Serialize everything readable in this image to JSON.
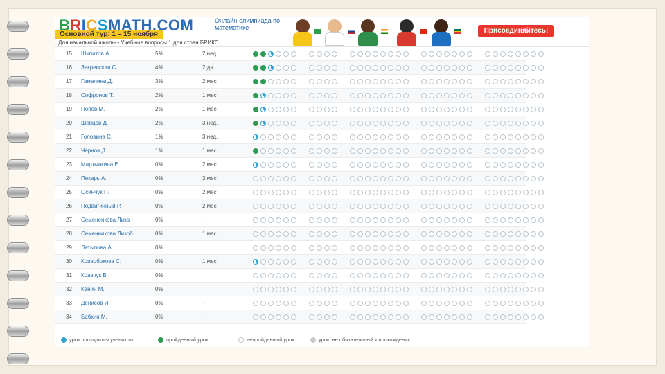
{
  "banner": {
    "logo": {
      "b": "B",
      "r": "R",
      "i": "I",
      "c": "C",
      "s": "S",
      "rest": "MATH.COM"
    },
    "tagline": "Онлайн-олимпиада по математике",
    "round_badge": "Основной тур: 1 – 15 ноября",
    "subtitle": "Для начальной школы • Учебные вопросы 1 для стран БРИКС",
    "join_button": "Присоединяйтесь!"
  },
  "colors": {
    "done": "#2e9b53",
    "in_progress": "#35a3d0",
    "not_done": "#ffffff",
    "optional": "#c8c8c8",
    "join_button": "#e8362d",
    "round_badge": "#f7c51f"
  },
  "students": [
    {
      "num": "15",
      "name": "Шипитов А.",
      "pct": "5%",
      "time": "2 нед.",
      "done": 2,
      "progress": 1
    },
    {
      "num": "16",
      "name": "Закревская С.",
      "pct": "4%",
      "time": "2 дн.",
      "done": 2,
      "progress": 1
    },
    {
      "num": "17",
      "name": "Гамалина Д.",
      "pct": "3%",
      "time": "2 мес",
      "done": 2,
      "progress": 0
    },
    {
      "num": "18",
      "name": "Софронов Т.",
      "pct": "2%",
      "time": "1 мес",
      "done": 1,
      "progress": 1
    },
    {
      "num": "19",
      "name": "Попов М.",
      "pct": "2%",
      "time": "1 мес",
      "done": 1,
      "progress": 1
    },
    {
      "num": "20",
      "name": "Шевцов Д.",
      "pct": "2%",
      "time": "3 нед.",
      "done": 1,
      "progress": 1
    },
    {
      "num": "21",
      "name": "Головина С.",
      "pct": "1%",
      "time": "3 нед.",
      "done": 0,
      "progress": 1
    },
    {
      "num": "22",
      "name": "Чернов Д.",
      "pct": "1%",
      "time": "1 мес",
      "done": 1,
      "progress": 0
    },
    {
      "num": "23",
      "name": "Мартынкина Е.",
      "pct": "0%",
      "time": "2 мес",
      "done": 0,
      "progress": 1
    },
    {
      "num": "24",
      "name": "Пекарь А.",
      "pct": "0%",
      "time": "3 мес",
      "done": 0,
      "progress": 0
    },
    {
      "num": "25",
      "name": "Осинчук П.",
      "pct": "0%",
      "time": "2 мес",
      "done": 0,
      "progress": 0
    },
    {
      "num": "26",
      "name": "Подвигичный Р.",
      "pct": "0%",
      "time": "2 мес",
      "done": 0,
      "progress": 0
    },
    {
      "num": "27",
      "name": "Семененкова Лиза",
      "pct": "0%",
      "time": "-",
      "done": 0,
      "progress": 0
    },
    {
      "num": "28",
      "name": "Семенникова Лизоб.",
      "pct": "0%",
      "time": "1 мес",
      "done": 0,
      "progress": 0
    },
    {
      "num": "29",
      "name": "Летыпова А.",
      "pct": "0%",
      "time": "",
      "done": 0,
      "progress": 0
    },
    {
      "num": "30",
      "name": "Кривобокова С.",
      "pct": "0%",
      "time": "1 мес",
      "done": 0,
      "progress": 1
    },
    {
      "num": "31",
      "name": "Кравчук В.",
      "pct": "0%",
      "time": "",
      "done": 0,
      "progress": 0
    },
    {
      "num": "32",
      "name": "Канин М.",
      "pct": "0%",
      "time": "",
      "done": 0,
      "progress": 0
    },
    {
      "num": "33",
      "name": "Денисов И.",
      "pct": "0%",
      "time": "-",
      "done": 0,
      "progress": 0
    },
    {
      "num": "34",
      "name": "Бабкин М.",
      "pct": "0%",
      "time": "-",
      "done": 0,
      "progress": 0
    }
  ],
  "legend": [
    {
      "label": "урок проходится учеником",
      "color": "#35a3d0"
    },
    {
      "label": "пройденный урок",
      "color": "#2e9b53"
    },
    {
      "label": "непройденный урок",
      "color": "#ffffff"
    },
    {
      "label": "урок, не обязательный к прохождению",
      "color": "#c8c8c8"
    }
  ]
}
